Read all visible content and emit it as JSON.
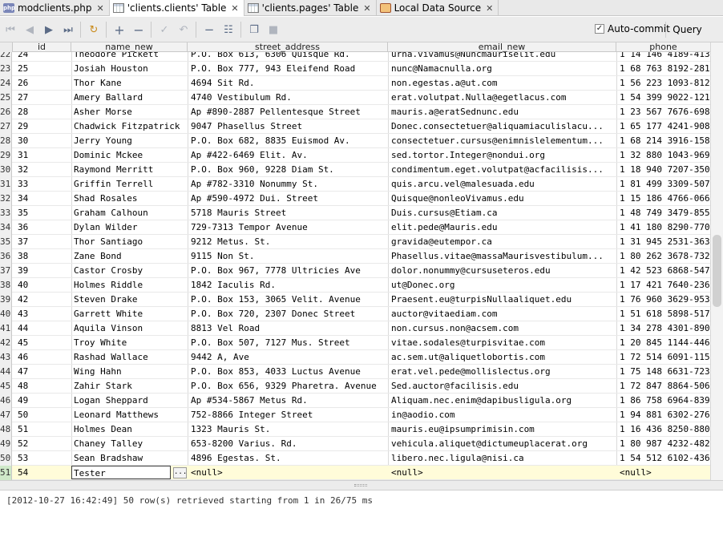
{
  "tabs": [
    {
      "label": "modclients.php",
      "icon": "php-file-icon"
    },
    {
      "label": "'clients.clients' Table",
      "icon": "table-icon",
      "active": true
    },
    {
      "label": "'clients.pages' Table",
      "icon": "table-icon"
    },
    {
      "label": "Local Data Source",
      "icon": "datasource-icon"
    }
  ],
  "toolbar": {
    "autocommit_label": "Auto-commit",
    "autocommit_checked": true,
    "query_label": "Query"
  },
  "columns": [
    "id",
    "name_new",
    "street_address",
    "email_new",
    "phone"
  ],
  "rows": [
    {
      "n": "22",
      "id": "24",
      "name": "Theodore Pickett",
      "addr": "P.O. Box 613, 6306 Quisque Rd.",
      "email": "urna.vivamus@Nuncmauriselit.edu",
      "phone": "1 14 146 4189-413"
    },
    {
      "n": "23",
      "id": "25",
      "name": "Josiah Houston",
      "addr": "P.O. Box 777, 943 Eleifend Road",
      "email": "nunc@Namacnulla.org",
      "phone": "1 68 763 8192-281"
    },
    {
      "n": "24",
      "id": "26",
      "name": "Thor Kane",
      "addr": "4694 Sit Rd.",
      "email": "non.egestas.a@ut.com",
      "phone": "1 56 223 1093-812"
    },
    {
      "n": "25",
      "id": "27",
      "name": "Amery Ballard",
      "addr": "4740 Vestibulum Rd.",
      "email": "erat.volutpat.Nulla@egetlacus.com",
      "phone": "1 54 399 9022-121"
    },
    {
      "n": "26",
      "id": "28",
      "name": "Asher Morse",
      "addr": "Ap #890-2887 Pellentesque Street",
      "email": "mauris.a@eratSednunc.edu",
      "phone": "1 23 567 7676-698"
    },
    {
      "n": "27",
      "id": "29",
      "name": "Chadwick Fitzpatrick",
      "addr": "9047 Phasellus Street",
      "email": "Donec.consectetuer@aliquamiaculislacu...",
      "phone": "1 65 177 4241-908"
    },
    {
      "n": "28",
      "id": "30",
      "name": "Jerry Young",
      "addr": "P.O. Box 682, 8835 Euismod Av.",
      "email": "consectetuer.cursus@enimnislelementum...",
      "phone": "1 68 214 3916-158"
    },
    {
      "n": "29",
      "id": "31",
      "name": "Dominic Mckee",
      "addr": "Ap #422-6469 Elit. Av.",
      "email": "sed.tortor.Integer@nondui.org",
      "phone": "1 32 880 1043-969"
    },
    {
      "n": "30",
      "id": "32",
      "name": "Raymond Merritt",
      "addr": "P.O. Box 960, 9228 Diam St.",
      "email": "condimentum.eget.volutpat@acfacilisis...",
      "phone": "1 18 940 7207-350"
    },
    {
      "n": "31",
      "id": "33",
      "name": "Griffin Terrell",
      "addr": "Ap #782-3310 Nonummy St.",
      "email": "quis.arcu.vel@malesuada.edu",
      "phone": "1 81 499 3309-507"
    },
    {
      "n": "32",
      "id": "34",
      "name": "Shad Rosales",
      "addr": "Ap #590-4972 Dui. Street",
      "email": "Quisque@nonleoVivamus.edu",
      "phone": "1 15 186 4766-066"
    },
    {
      "n": "33",
      "id": "35",
      "name": "Graham Calhoun",
      "addr": "5718 Mauris Street",
      "email": "Duis.cursus@Etiam.ca",
      "phone": "1 48 749 3479-855"
    },
    {
      "n": "34",
      "id": "36",
      "name": "Dylan Wilder",
      "addr": "729-7313 Tempor Avenue",
      "email": "elit.pede@Mauris.edu",
      "phone": "1 41 180 8290-770"
    },
    {
      "n": "35",
      "id": "37",
      "name": "Thor Santiago",
      "addr": "9212 Metus. St.",
      "email": "gravida@eutempor.ca",
      "phone": "1 31 945 2531-363"
    },
    {
      "n": "36",
      "id": "38",
      "name": "Zane Bond",
      "addr": "9115 Non St.",
      "email": "Phasellus.vitae@massaMaurisvestibulum...",
      "phone": "1 80 262 3678-732"
    },
    {
      "n": "37",
      "id": "39",
      "name": "Castor Crosby",
      "addr": "P.O. Box 967, 7778 Ultricies Ave",
      "email": "dolor.nonummy@cursuseteros.edu",
      "phone": "1 42 523 6868-547"
    },
    {
      "n": "38",
      "id": "40",
      "name": "Holmes Riddle",
      "addr": "1842 Iaculis Rd.",
      "email": "ut@Donec.org",
      "phone": "1 17 421 7640-236"
    },
    {
      "n": "39",
      "id": "42",
      "name": "Steven Drake",
      "addr": "P.O. Box 153, 3065 Velit. Avenue",
      "email": "Praesent.eu@turpisNullaaliquet.edu",
      "phone": "1 76 960 3629-953"
    },
    {
      "n": "40",
      "id": "43",
      "name": "Garrett White",
      "addr": "P.O. Box 720, 2307 Donec Street",
      "email": "auctor@vitaediam.com",
      "phone": "1 51 618 5898-517"
    },
    {
      "n": "41",
      "id": "44",
      "name": "Aquila Vinson",
      "addr": "8813 Vel Road",
      "email": "non.cursus.non@acsem.com",
      "phone": "1 34 278 4301-890"
    },
    {
      "n": "42",
      "id": "45",
      "name": "Troy White",
      "addr": "P.O. Box 507, 7127 Mus. Street",
      "email": "vitae.sodales@turpisvitae.com",
      "phone": "1 20 845 1144-446"
    },
    {
      "n": "43",
      "id": "46",
      "name": "Rashad Wallace",
      "addr": "9442 A, Ave",
      "email": "ac.sem.ut@aliquetlobortis.com",
      "phone": "1 72 514 6091-115"
    },
    {
      "n": "44",
      "id": "47",
      "name": "Wing Hahn",
      "addr": "P.O. Box 853, 4033 Luctus Avenue",
      "email": "erat.vel.pede@mollislectus.org",
      "phone": "1 75 148 6631-723"
    },
    {
      "n": "45",
      "id": "48",
      "name": "Zahir Stark",
      "addr": "P.O. Box 656, 9329 Pharetra. Avenue",
      "email": "Sed.auctor@facilisis.edu",
      "phone": "1 72 847 8864-506"
    },
    {
      "n": "46",
      "id": "49",
      "name": "Logan Sheppard",
      "addr": "Ap #534-5867 Metus Rd.",
      "email": "Aliquam.nec.enim@dapibusligula.org",
      "phone": "1 86 758 6964-839"
    },
    {
      "n": "47",
      "id": "50",
      "name": "Leonard Matthews",
      "addr": "752-8866 Integer Street",
      "email": "in@aodio.com",
      "phone": "1 94 881 6302-276"
    },
    {
      "n": "48",
      "id": "51",
      "name": "Holmes Dean",
      "addr": "1323 Mauris St.",
      "email": "mauris.eu@ipsumprimisin.com",
      "phone": "1 16 436 8250-880"
    },
    {
      "n": "49",
      "id": "52",
      "name": "Chaney Talley",
      "addr": "653-8200 Varius. Rd.",
      "email": "vehicula.aliquet@dictumeuplacerat.org",
      "phone": "1 80 987 4232-482"
    },
    {
      "n": "50",
      "id": "53",
      "name": "Sean Bradshaw",
      "addr": "4896 Egestas. St.",
      "email": "libero.nec.ligula@nisi.ca",
      "phone": "1 54 512 6102-436"
    }
  ],
  "edit_row": {
    "n": "51",
    "id": "54",
    "name": "Tester",
    "addr": "<null>",
    "email": "<null>",
    "phone": "<null>",
    "ellipsis": "..."
  },
  "console": {
    "message": "[2012-10-27 16:42:49] 50 row(s) retrieved starting from 1 in 26/75 ms"
  }
}
